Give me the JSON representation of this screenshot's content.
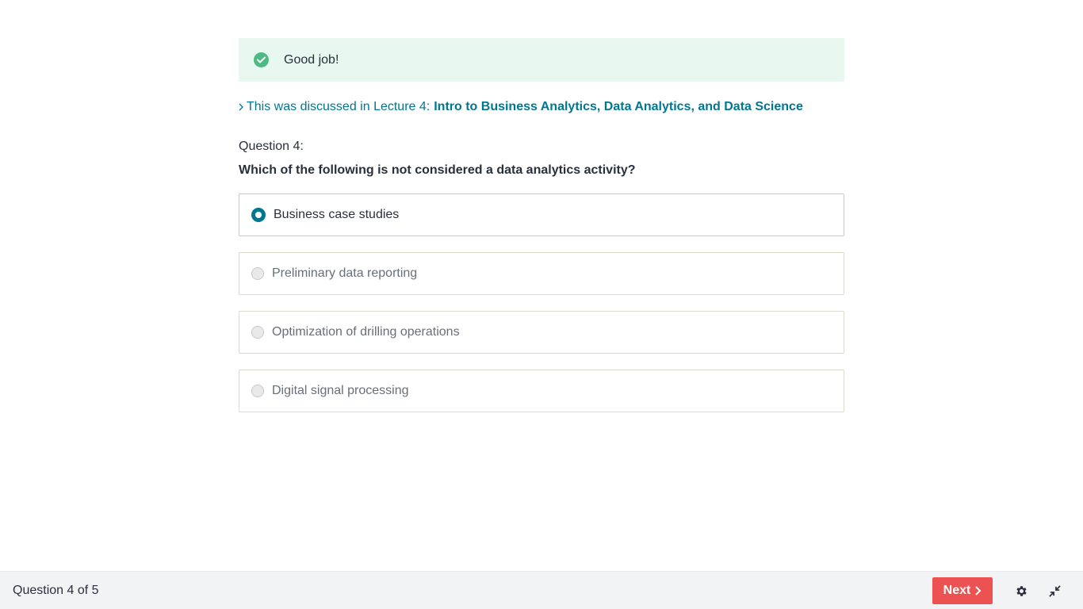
{
  "feedback": {
    "message": "Good job!",
    "status_color": "#4cba83",
    "icon": "check-circle-icon"
  },
  "lecture_reference": {
    "prefix": "This was discussed in Lecture 4:",
    "link_text": "Intro to Business Analytics, Data Analytics, and Data Science",
    "icon": "chevron-right-icon"
  },
  "question": {
    "number_label": "Question 4:",
    "text": "Which of the following is not considered a data analytics activity?",
    "options": [
      {
        "label": "Business case studies",
        "selected": true
      },
      {
        "label": "Preliminary data reporting",
        "selected": false
      },
      {
        "label": "Optimization of drilling operations",
        "selected": false
      },
      {
        "label": "Digital signal processing",
        "selected": false
      }
    ]
  },
  "footer": {
    "progress": "Question 4 of 5",
    "next_label": "Next",
    "next_color": "#ec5252",
    "settings_icon": "gear-icon",
    "collapse_icon": "collapse-icon"
  },
  "colors": {
    "accent": "#007791",
    "feedback_bg": "#e8f7ef"
  }
}
